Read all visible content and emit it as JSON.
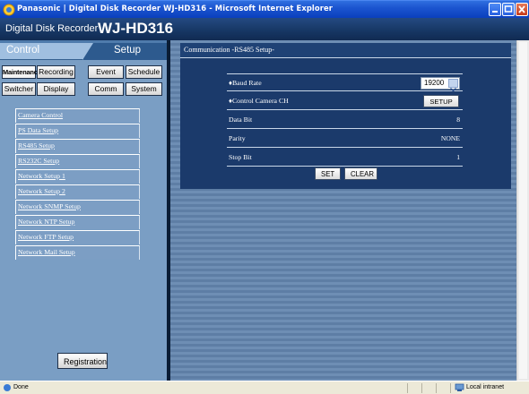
{
  "window": {
    "title": "Panasonic | Digital Disk Recorder WJ-HD316 - Microsoft Internet Explorer"
  },
  "app_header": {
    "product": "Digital Disk Recorder",
    "model": "WJ-HD316"
  },
  "tabs": {
    "control": "Control",
    "setup": "Setup"
  },
  "categories": {
    "maintenance": "Maintenance",
    "recording": "Recording",
    "event": "Event",
    "schedule": "Schedule",
    "switcher": "Switcher",
    "display": "Display",
    "comm": "Comm",
    "system": "System"
  },
  "menu": {
    "items": [
      "Camera Control",
      "PS Data Setup",
      "RS485 Setup",
      "RS232C Setup",
      "Network Setup 1",
      "Network Setup 2",
      "Network SNMP Setup",
      "Network NTP Setup",
      "Network FTP Setup",
      "Network Mail Setup"
    ]
  },
  "registration_label": "Registration",
  "panel": {
    "title": "Communication -RS485 Setup-",
    "baud_rate_label": "♦Baud Rate",
    "baud_rate_value": "19200",
    "control_camera_label": "♦Control Camera CH",
    "setup_button": "SETUP",
    "data_bit_label": "Data Bit",
    "data_bit_value": "8",
    "parity_label": "Parity",
    "parity_value": "NONE",
    "stop_bit_label": "Stop Bit",
    "stop_bit_value": "1",
    "set_button": "SET",
    "clear_button": "CLEAR"
  },
  "status": {
    "left": "Done",
    "zone": "Local intranet"
  },
  "colors": {
    "titlebar": "#1c55d0",
    "panel_bg": "#1b3a6b",
    "left_panel_bg": "#7a9ec4",
    "menu_item_bg": "#7c9ec4"
  }
}
